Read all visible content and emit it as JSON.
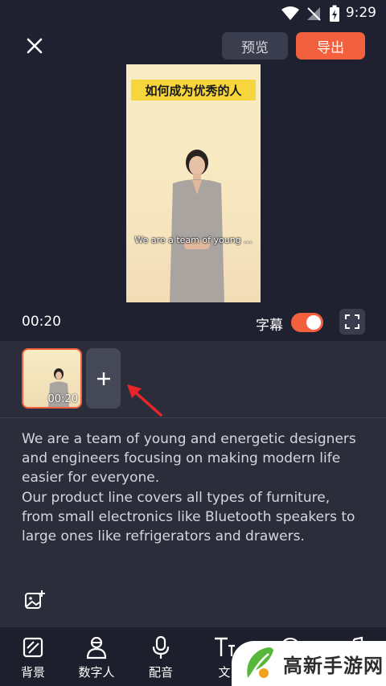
{
  "status_bar": {
    "time": "9:29"
  },
  "header": {
    "preview_label": "预览",
    "export_label": "导出"
  },
  "video": {
    "title_banner": "如何成为优秀的人",
    "subtitle": "We are a team of young ..."
  },
  "player": {
    "current_time": "00:20",
    "caption_label": "字幕",
    "caption_on": true
  },
  "clips": [
    {
      "duration": "00:20"
    }
  ],
  "script_lines": [
    "We are a team of young and energetic designers and engineers focusing on making modern life easier for everyone.",
    "Our product line covers all types of furniture, from small electronics like Bluetooth speakers to large ones like refrigerators and drawers."
  ],
  "toolbar": {
    "items": [
      {
        "label": "背景",
        "icon": "background-icon"
      },
      {
        "label": "数字人",
        "icon": "digital-human-icon"
      },
      {
        "label": "配音",
        "icon": "microphone-icon"
      },
      {
        "label": "文",
        "icon": "text-icon"
      },
      {
        "label": "",
        "icon": "sticker-icon"
      },
      {
        "label": "",
        "icon": "music-icon"
      }
    ]
  },
  "watermark": {
    "text": "高新手游网"
  },
  "colors": {
    "accent": "#f2603e",
    "background": "#1f2130",
    "panel": "#2b2d3b"
  }
}
